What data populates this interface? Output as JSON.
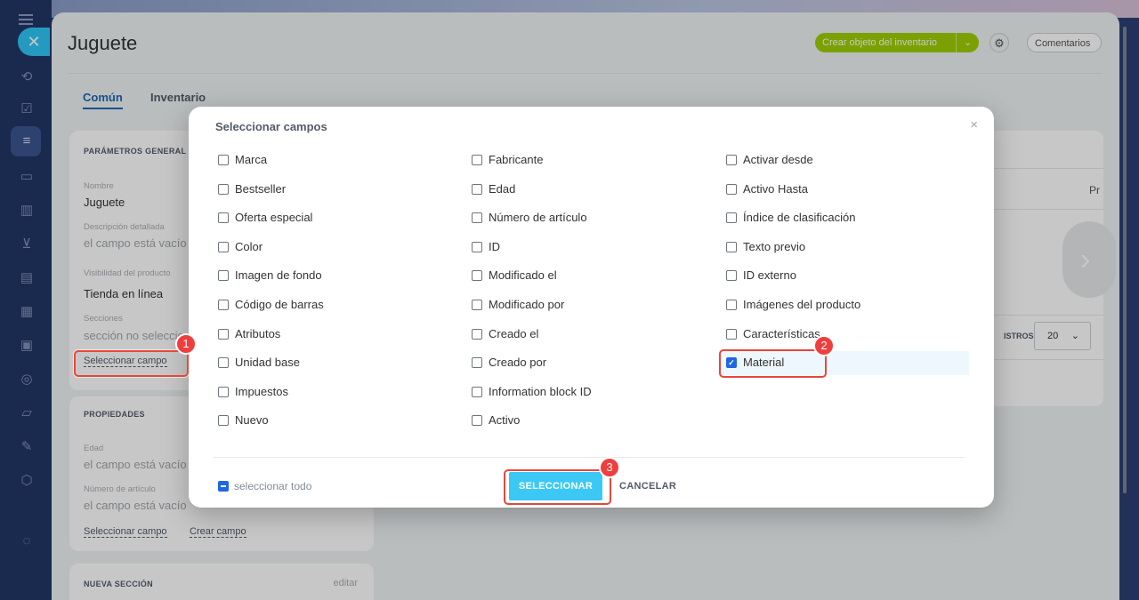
{
  "page": {
    "title": "Juguete",
    "create_button": "Crear objeto del inventario",
    "comments_button": "Comentarios",
    "tabs": [
      "Común",
      "Inventario"
    ]
  },
  "params_card": {
    "section_title": "PARÁMETROS GENERAL",
    "name_label": "Nombre",
    "name_value": "Juguete",
    "desc_label": "Descripción detallada",
    "desc_value": "el campo está vacío",
    "visibility_label": "Visibilidad del producto",
    "visibility_value": "Tienda en línea",
    "sections_label": "Secciones",
    "sections_value": "sección no seleccionada",
    "select_field_link": "Seleccionar campo"
  },
  "props_card": {
    "section_title": "PROPIEDADES",
    "age_label": "Edad",
    "age_value": "el campo está vacío",
    "article_label": "Número de artículo",
    "article_value": "el campo está vacío",
    "select_field_link": "Seleccionar campo",
    "create_field_link": "Crear campo"
  },
  "new_section_card": {
    "section_title": "NUEVA SECCIÓN",
    "edit_link": "editar"
  },
  "right_card": {
    "pr_text": "Pr",
    "records_label": "ISTROS:",
    "page_size": "20"
  },
  "modal": {
    "title": "Seleccionar campos",
    "columns": [
      [
        {
          "label": "Marca",
          "checked": false
        },
        {
          "label": "Bestseller",
          "checked": false
        },
        {
          "label": "Oferta especial",
          "checked": false
        },
        {
          "label": "Color",
          "checked": false
        },
        {
          "label": "Imagen de fondo",
          "checked": false
        },
        {
          "label": "Código de barras",
          "checked": false
        },
        {
          "label": "Atributos",
          "checked": false
        },
        {
          "label": "Unidad base",
          "checked": false
        },
        {
          "label": "Impuestos",
          "checked": false
        },
        {
          "label": "Nuevo",
          "checked": false
        }
      ],
      [
        {
          "label": "Fabricante",
          "checked": false
        },
        {
          "label": "Edad",
          "checked": false
        },
        {
          "label": "Número de artículo",
          "checked": false
        },
        {
          "label": "ID",
          "checked": false
        },
        {
          "label": "Modificado el",
          "checked": false
        },
        {
          "label": "Modificado por",
          "checked": false
        },
        {
          "label": "Creado el",
          "checked": false
        },
        {
          "label": "Creado por",
          "checked": false
        },
        {
          "label": "Information block ID",
          "checked": false
        },
        {
          "label": "Activo",
          "checked": false
        }
      ],
      [
        {
          "label": "Activar desde",
          "checked": false
        },
        {
          "label": "Activo Hasta",
          "checked": false
        },
        {
          "label": "Índice de clasificación",
          "checked": false
        },
        {
          "label": "Texto previo",
          "checked": false
        },
        {
          "label": "ID externo",
          "checked": false
        },
        {
          "label": "Imágenes del producto",
          "checked": false
        },
        {
          "label": "Características",
          "checked": false
        },
        {
          "label": "Material",
          "checked": true
        }
      ]
    ],
    "select_all": "seleccionar todo",
    "select_button": "SELECCIONAR",
    "cancel_button": "CANCELAR"
  },
  "annotations": [
    "1",
    "2",
    "3"
  ],
  "colors": {
    "accent": "#3bc8f5",
    "create_green": "#9dcf00",
    "annotation_red": "#e6473a",
    "link_blue": "#2067b0"
  }
}
